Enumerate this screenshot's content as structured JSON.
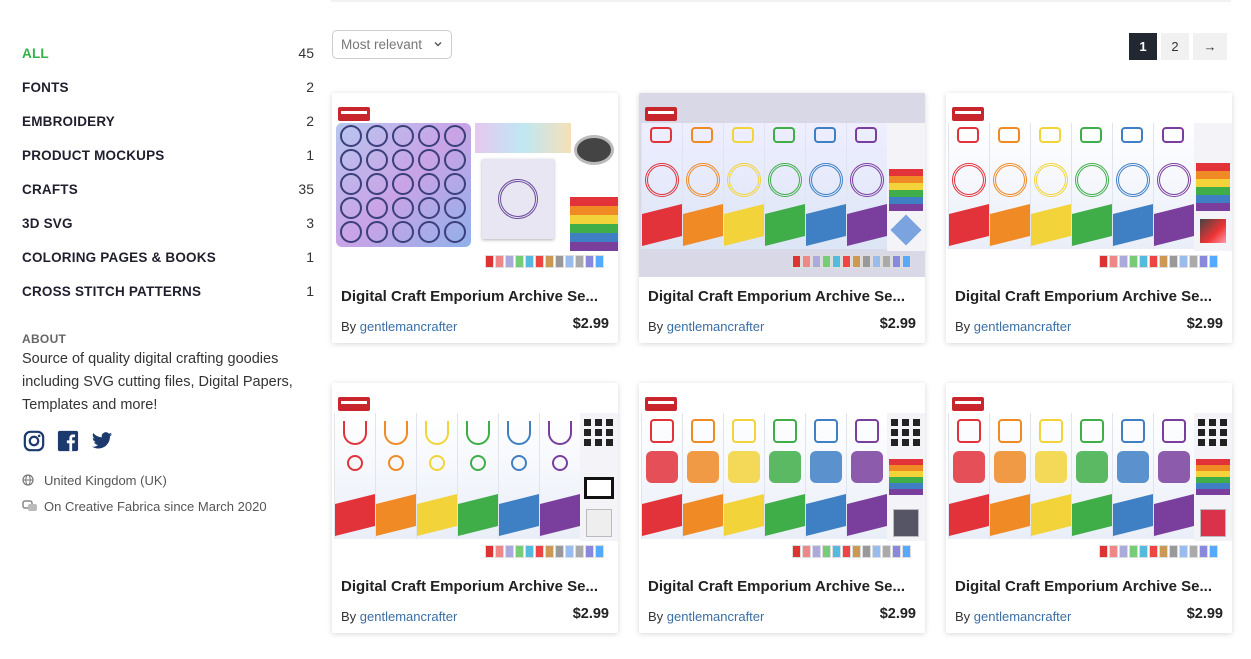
{
  "sidebar": {
    "categories": [
      {
        "label": "ALL",
        "count": "45"
      },
      {
        "label": "FONTS",
        "count": "2"
      },
      {
        "label": "EMBROIDERY",
        "count": "2"
      },
      {
        "label": "PRODUCT MOCKUPS",
        "count": "1"
      },
      {
        "label": "CRAFTS",
        "count": "35"
      },
      {
        "label": "3D SVG",
        "count": "3"
      },
      {
        "label": "COLORING PAGES & BOOKS",
        "count": "1"
      },
      {
        "label": "CROSS STITCH PATTERNS",
        "count": "1"
      }
    ],
    "about_title": "ABOUT",
    "about_text": "Source of quality digital crafting goodies including SVG cutting files, Digital Papers, Templates and more!",
    "location": "United Kingdom (UK)",
    "since": "On Creative Fabrica since March 2020",
    "social": [
      "instagram-icon",
      "facebook-icon",
      "twitter-icon"
    ]
  },
  "toolbar": {
    "sort_value": "Most relevant",
    "pages": [
      "1",
      "2"
    ],
    "next": "→"
  },
  "products": [
    {
      "title": "Digital Craft Emporium Archive Se...",
      "by": "By",
      "author": "gentlemancrafter",
      "price": "$2.99"
    },
    {
      "title": "Digital Craft Emporium Archive Se...",
      "by": "By",
      "author": "gentlemancrafter",
      "price": "$2.99"
    },
    {
      "title": "Digital Craft Emporium Archive Se...",
      "by": "By",
      "author": "gentlemancrafter",
      "price": "$2.99"
    },
    {
      "title": "Digital Craft Emporium Archive Se...",
      "by": "By",
      "author": "gentlemancrafter",
      "price": "$2.99"
    },
    {
      "title": "Digital Craft Emporium Archive Se...",
      "by": "By",
      "author": "gentlemancrafter",
      "price": "$2.99"
    },
    {
      "title": "Digital Craft Emporium Archive Se...",
      "by": "By",
      "author": "gentlemancrafter",
      "price": "$2.99"
    }
  ],
  "colors": {
    "active_category": "#33b249",
    "author_link": "#3a6ea5",
    "pager_active": "#222831",
    "rainbow": [
      "#e2333b",
      "#f08a24",
      "#f2d43a",
      "#3fae49",
      "#3f80c4",
      "#7a3f9d"
    ]
  }
}
